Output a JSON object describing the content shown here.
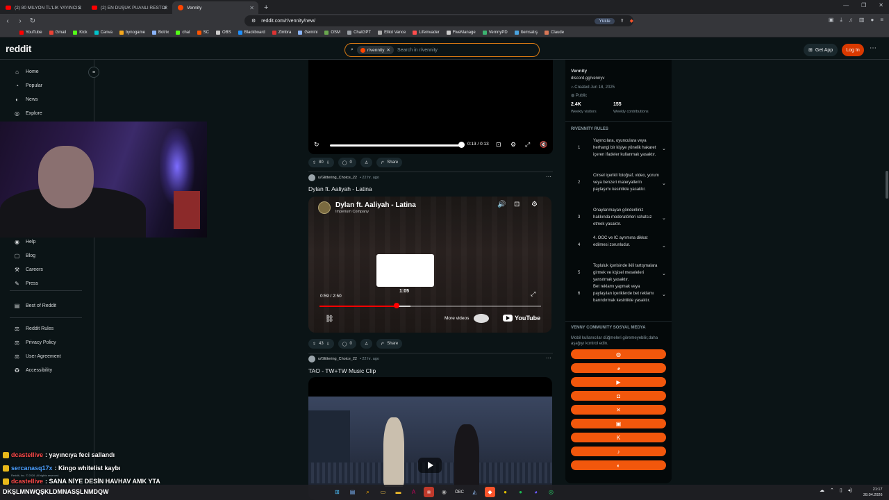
{
  "browser": {
    "tabs": [
      {
        "label": "(2) 80 MİLYON TL'LİK YAYINCI EVİM",
        "icon": "youtube-icon"
      },
      {
        "label": "(2) EN DÜŞÜK PUANLI RESTORANLA",
        "icon": "youtube-icon"
      },
      {
        "label": "Vennity",
        "icon": "reddit-icon",
        "active": true
      }
    ],
    "new_tab": "+",
    "url": "reddit.com/r/vennity/new/",
    "translate_label": "Yükle",
    "bookmarks": [
      "YouTube",
      "Gmail",
      "Kick",
      "Canva",
      "bynogame",
      "Botrix",
      "chat",
      "SC",
      "OBS",
      "Blackboard",
      "Zimbra",
      "Gemini",
      "OSM",
      "ChatGPT",
      "Elliot Vance",
      "Lifeinvader",
      "FiveManage",
      "VernnyPD",
      "Itemsatış",
      "Claude"
    ]
  },
  "header": {
    "logo": "reddit",
    "search_chip": "r/vennity",
    "search_placeholder": "Search in r/vennity",
    "get_app": "Get App",
    "login": "Log In"
  },
  "leftnav": {
    "top": [
      {
        "label": "Home",
        "icon": "home-icon"
      },
      {
        "label": "Popular",
        "icon": "popular-icon"
      },
      {
        "label": "News",
        "icon": "news-icon"
      },
      {
        "label": "Explore",
        "icon": "explore-icon"
      }
    ],
    "middle": [
      {
        "label": "Help",
        "icon": "help-icon"
      },
      {
        "label": "Blog",
        "icon": "blog-icon"
      },
      {
        "label": "Careers",
        "icon": "careers-icon"
      },
      {
        "label": "Press",
        "icon": "press-icon"
      }
    ],
    "best": {
      "label": "Best of Reddit",
      "icon": "best-icon"
    },
    "bottom": [
      {
        "label": "Reddit Rules",
        "icon": "rules-icon"
      },
      {
        "label": "Privacy Policy",
        "icon": "privacy-icon"
      },
      {
        "label": "User Agreement",
        "icon": "agreement-icon"
      },
      {
        "label": "Accessibility",
        "icon": "accessibility-icon"
      }
    ]
  },
  "feed": {
    "video1": {
      "time": "0:13 / 0:13",
      "progress": 1.0,
      "votes": "80",
      "comments": "0",
      "share": "Share"
    },
    "post2": {
      "author": "u/Glittering_Choice_22",
      "age": "• 22 hr. ago",
      "title": "Dylan ft. Aaliyah - Latina",
      "yt_title": "Dylan ft. Aaliyah - Latina",
      "yt_channel": "Imperium Company",
      "yt_time": "0:59 / 2:50",
      "yt_hover_time": "1:05",
      "yt_progress": 0.347,
      "more_videos": "More videos",
      "youtube_logo": "YouTube",
      "votes": "43",
      "comments": "0",
      "share": "Share"
    },
    "post3": {
      "author": "u/Glittering_Choice_22",
      "age": "• 22 hr. ago",
      "title": "TAO - TW+TW Music Clip"
    }
  },
  "rside": {
    "name": "Vennity",
    "link": "discord.gg/vennyv",
    "created": "Created Jun 18, 2025",
    "visibility": "Public",
    "visitors": "2.4K",
    "visitors_label": "Weekly visitors",
    "contributions": "155",
    "contributions_label": "Weekly contributions",
    "rules_title": "R/VENNITY RULES",
    "rules": [
      {
        "num": "1",
        "text": "Yayıncılara, oyunculara veya herhangi bir kişiye yönelik hakaret içeren ifadeler kullanmak yasaktır."
      },
      {
        "num": "2",
        "text": "Cinsel içerikli fotoğraf, video, yorum veya benzeri materyallerin paylaşımı kesinlikle yasaktır."
      },
      {
        "num": "3",
        "text": "Onaylanmayan gönderiliniz hakkında moderatörleri rahatsız etmek yasaktır."
      },
      {
        "num": "4",
        "text": "4. OOC ve IC ayrımına dikkat edilmesi zorunludur."
      },
      {
        "num": "5",
        "text": "Topluluk içerisinde ikili tartışmalara girmek ve kişisel meseleleri yansıtmak yasaktır."
      },
      {
        "num": "6",
        "text": "Bet reklamı yapmak veya paylaşılan içeriklerde bet reklamı barındırmak kesinlikle yasaktır."
      }
    ],
    "social_title": "VENNY COMMUNITY SOSYAL MEDYA",
    "social_note": "Mobil kullanıcılar düğmeleri göremeyebilir,daha aşağıyı kontrol edin.",
    "social_buttons": [
      "globe-icon",
      "discord-icon",
      "youtube-icon",
      "instagram-icon",
      "x-icon",
      "twitch-icon",
      "kick-icon",
      "tiktok-icon",
      "steam-icon"
    ]
  },
  "chat": [
    {
      "user": "dcastellive",
      "msg": ": yayıncıya feci sallandı"
    },
    {
      "user": "sercanasq17x",
      "msg": ": Kingo whitelist kaybı"
    },
    {
      "user": "dcastellive",
      "msg": ": SANA NİYE DESİN HAVHAV AMK YTA"
    }
  ],
  "footnote": "Reddit, Inc. © 2026. All rights reserved.",
  "bigtext": "DKŞLMNWQŞKLDMNASŞLNMDQW",
  "clock": {
    "time": "21:17",
    "date": "28.04.2026"
  }
}
